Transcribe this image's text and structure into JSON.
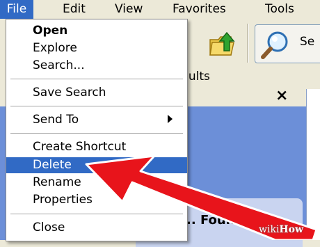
{
  "menubar": {
    "items": [
      "File",
      "Edit",
      "View",
      "Favorites",
      "Tools"
    ]
  },
  "toolbar": {
    "search_label": "Se"
  },
  "addressbar": {
    "results_label": "sults"
  },
  "pane": {
    "close_symbol": "×",
    "found_text": ".. Found"
  },
  "file_menu": {
    "items": [
      {
        "label": "Open",
        "bold": true
      },
      {
        "label": "Explore"
      },
      {
        "label": "Search..."
      },
      {
        "label": "Save Search"
      },
      {
        "label": "Send To",
        "submenu": true
      },
      {
        "label": "Create Shortcut"
      },
      {
        "label": "Delete",
        "highlighted": true
      },
      {
        "label": "Rename"
      },
      {
        "label": "Properties"
      },
      {
        "label": "Close"
      }
    ]
  },
  "colors": {
    "highlight": "#316AC5",
    "arrow": "#E8141B",
    "menubar_bg": "#ECE9D8"
  },
  "watermark": {
    "prefix": "wiki",
    "suffix": "How"
  }
}
